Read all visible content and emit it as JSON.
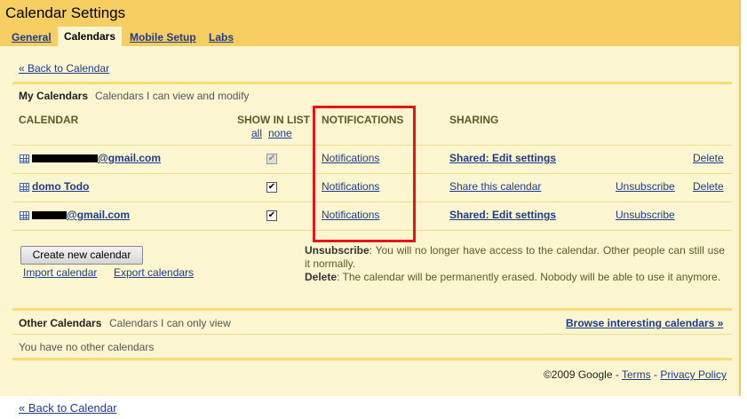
{
  "app_title": "Calendar Settings",
  "tabs": [
    {
      "label": "General"
    },
    {
      "label": "Calendars"
    },
    {
      "label": "Mobile Setup"
    },
    {
      "label": "Labs"
    }
  ],
  "back_link": "« Back to Calendar",
  "my_calendars": {
    "title": "My Calendars",
    "subtitle": "Calendars I can view and modify",
    "columns": {
      "calendar": "CALENDAR",
      "show_in_list": "SHOW IN LIST",
      "all": "all",
      "none": "none",
      "notifications": "NOTIFICATIONS",
      "sharing": "SHARING"
    },
    "rows": [
      {
        "name": "@gmail.com",
        "notifications": "Notifications",
        "sharing": "Shared: Edit settings",
        "unsubscribe": "",
        "delete": "Delete"
      },
      {
        "name": "domo Todo",
        "notifications": "Notifications",
        "sharing": "Share this calendar",
        "unsubscribe": "Unsubscribe",
        "delete": "Delete"
      },
      {
        "name": "@gmail.com",
        "notifications": "Notifications",
        "sharing": "Shared: Edit settings",
        "unsubscribe": "Unsubscribe",
        "delete": ""
      }
    ],
    "create_button": "Create new calendar",
    "import_link": "Import calendar",
    "export_link": "Export calendars",
    "help": {
      "unsubscribe_term": "Unsubscribe",
      "unsubscribe_text": ": You will no longer have access to the calendar. Other people can still use it normally.",
      "delete_term": "Delete",
      "delete_text": ": The calendar will be permanently erased. Nobody will be able to use it anymore."
    }
  },
  "other_calendars": {
    "title": "Other Calendars",
    "subtitle": "Calendars I can only view",
    "browse_link": "Browse interesting calendars »",
    "empty_text": "You have no other calendars"
  },
  "footer": {
    "copyright": "©2009 Google - ",
    "terms": "Terms",
    "separator": " - ",
    "privacy": "Privacy Policy"
  },
  "colors": {
    "header_bg": "#f6ce62",
    "panel_bg": "#fbf6cf",
    "link": "#1f3b8f",
    "highlight_box": "#e3171a"
  }
}
